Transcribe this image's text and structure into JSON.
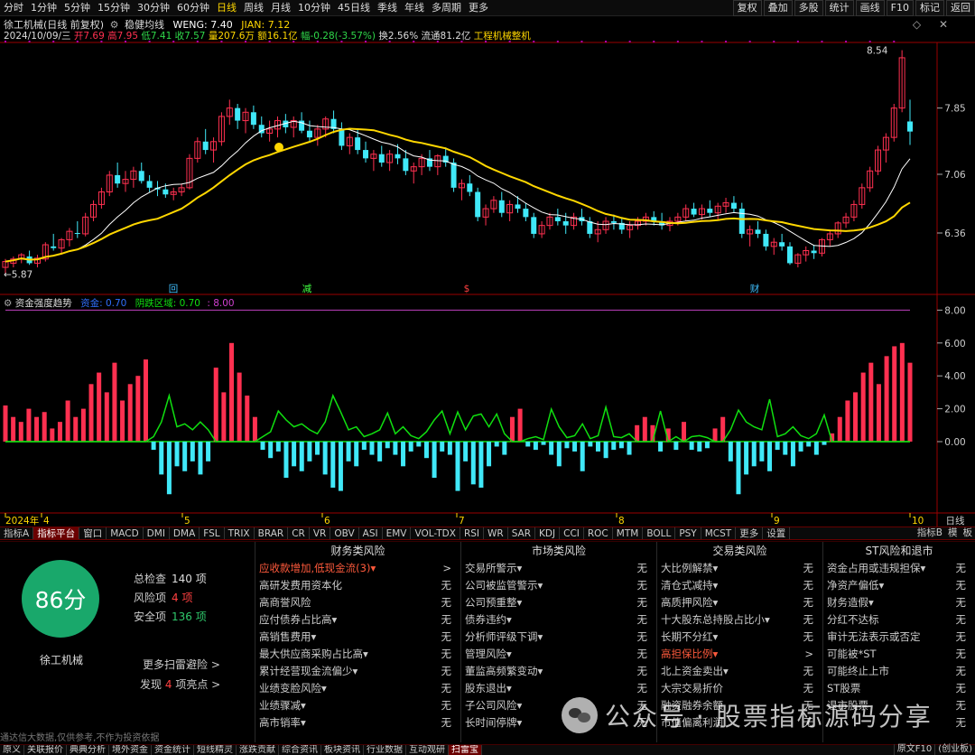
{
  "colors": {
    "up": "#ff3050",
    "down": "#40e8f8",
    "ma1": "#ffd700",
    "ma2": "#ffffff",
    "green": "#10e010",
    "purple": "#b000b0",
    "frame": "#9a0000"
  },
  "periods": [
    "分时",
    "1分钟",
    "5分钟",
    "15分钟",
    "30分钟",
    "60分钟",
    "日线",
    "周线",
    "月线",
    "10分钟",
    "45日线",
    "季线",
    "年线",
    "多周期",
    "更多"
  ],
  "active_period": "日线",
  "top_right": [
    "复权",
    "叠加",
    "多股",
    "统计",
    "画线",
    "F10",
    "标记",
    "返回"
  ],
  "title_line": {
    "name": "徐工机械(日线 前复权)",
    "indicator": "稳健均线",
    "weng": "WENG: 7.40",
    "jian": "JIAN: 7.12"
  },
  "info_line": {
    "date": "2024/10/09/三",
    "open": "开7.69",
    "high": "高7.95",
    "low": "低7.41",
    "close": "收7.57",
    "volume": "量207.6万",
    "amount": "额16.1亿",
    "change": "幅-0.28(-3.57%)",
    "turnover": "换2.56%",
    "float": "流通81.2亿",
    "sector": "工程机械整机"
  },
  "price_axis": {
    "labels": [
      "7.85",
      "7.06",
      "6.36"
    ],
    "max_label": "8.54",
    "min_label": "5.87"
  },
  "events": [
    "回",
    "减",
    "$",
    "财"
  ],
  "ind_head": {
    "name": "资金强度趋势",
    "a": "资金: 0.70",
    "b": "阴跌区域: 0.70",
    "c": ": 8.00"
  },
  "ind_axis": [
    "8.00",
    "6.00",
    "4.00",
    "2.00",
    "0.00"
  ],
  "date_axis": [
    "2024年",
    "4",
    "5",
    "6",
    "7",
    "8",
    "9",
    "10"
  ],
  "date_axis_label": "日线",
  "tabs": [
    "指标A",
    "指标平台",
    "窗口",
    "MACD",
    "DMI",
    "DMA",
    "FSL",
    "TRIX",
    "BRAR",
    "CR",
    "VR",
    "OBV",
    "ASI",
    "EMV",
    "VOL-TDX",
    "RSI",
    "WR",
    "SAR",
    "KDJ",
    "CCI",
    "ROC",
    "MTM",
    "BOLL",
    "PSY",
    "MCST",
    "更多",
    "设置"
  ],
  "active_tab": "指标平台",
  "tab_right": [
    "指标B",
    "模",
    "板"
  ],
  "score": {
    "value": "86分",
    "name": "徐工机械",
    "total_label": "总检查",
    "total": "140 项",
    "risk_label": "风险项",
    "risk": "4 项",
    "safe_label": "安全项",
    "safe": "136 项",
    "more": "更多扫雷避险 >",
    "found_pre": "发现",
    "found_num": "4",
    "found_post": "项亮点 >"
  },
  "columns": [
    {
      "title": "财务类风险",
      "rows": [
        [
          "应收款增加,低现金流(3)▾",
          ">"
        ],
        [
          "高研发费用资本化",
          "无"
        ],
        [
          "高商誉风险",
          "无"
        ],
        [
          "应付债券占比高▾",
          "无"
        ],
        [
          "高销售费用▾",
          "无"
        ],
        [
          "最大供应商采购占比高▾",
          "无"
        ],
        [
          "累计经营现金流偏少▾",
          "无"
        ],
        [
          "业绩变脸风险▾",
          "无"
        ],
        [
          "业绩骤减▾",
          "无"
        ],
        [
          "高市销率▾",
          "无"
        ]
      ],
      "hl": 0
    },
    {
      "title": "市场类风险",
      "rows": [
        [
          "交易所警示▾",
          "无"
        ],
        [
          "公司被监管警示▾",
          "无"
        ],
        [
          "公司预重整▾",
          "无"
        ],
        [
          "债券违约▾",
          "无"
        ],
        [
          "分析师评级下调▾",
          "无"
        ],
        [
          "管理风险▾",
          "无"
        ],
        [
          "董监高频繁变动▾",
          "无"
        ],
        [
          "股东退出▾",
          "无"
        ],
        [
          "子公司风险▾",
          "无"
        ],
        [
          "长时间停牌▾",
          "无"
        ]
      ],
      "hl": -1
    },
    {
      "title": "交易类风险",
      "rows": [
        [
          "大比例解禁▾",
          "无"
        ],
        [
          "清仓式减持▾",
          "无"
        ],
        [
          "高质押风险▾",
          "无"
        ],
        [
          "十大股东总持股占比小▾",
          "无"
        ],
        [
          "长期不分红▾",
          "无"
        ],
        [
          "高担保比例▾",
          ">"
        ],
        [
          "北上资金卖出▾",
          "无"
        ],
        [
          "大宗交易折价",
          "无"
        ],
        [
          "融资融券余额",
          "无"
        ],
        [
          "市值偏离利润",
          "无"
        ]
      ],
      "hl": 5
    },
    {
      "title": "ST风险和退市",
      "rows": [
        [
          "资金占用或违规担保▾",
          "无"
        ],
        [
          "净资产偏低▾",
          "无"
        ],
        [
          "财务造假▾",
          "无"
        ],
        [
          "分红不达标",
          "无"
        ],
        [
          "审计无法表示或否定",
          "无"
        ],
        [
          "可能被*ST",
          "无"
        ],
        [
          "可能终止上市",
          "无"
        ],
        [
          "ST股票",
          "无"
        ],
        [
          "退市股票",
          "无"
        ],
        [
          "",
          "无"
        ]
      ],
      "hl": -1
    }
  ],
  "disclaimer": "通达信大数据,仅供参考,不作为投资依据",
  "bottom_tabs": [
    "原义",
    "关联报价",
    "典典分析",
    "境外资金",
    "资金统计",
    "短线精灵",
    "涨跌贡献",
    "综合资讯",
    "板块资讯",
    "行业数据",
    "互动观研",
    "扫雷宝"
  ],
  "active_bottom": "扫雷宝",
  "bottom_right": [
    "原文F10",
    "(创业板)"
  ],
  "watermark": "公众号 · 股票指标源码分享",
  "chart_data": {
    "type": "candlestick",
    "candles": [
      [
        5.95,
        6.05,
        5.88,
        6.02
      ],
      [
        6.0,
        6.08,
        5.95,
        6.05
      ],
      [
        6.05,
        6.12,
        6.0,
        6.1
      ],
      [
        6.08,
        6.15,
        5.98,
        6.0
      ],
      [
        6.0,
        6.1,
        5.95,
        6.06
      ],
      [
        6.05,
        6.25,
        6.02,
        6.22
      ],
      [
        6.2,
        6.35,
        6.15,
        6.18
      ],
      [
        6.18,
        6.3,
        6.1,
        6.28
      ],
      [
        6.28,
        6.42,
        6.2,
        6.38
      ],
      [
        6.36,
        6.5,
        6.3,
        6.35
      ],
      [
        6.35,
        6.6,
        6.32,
        6.55
      ],
      [
        6.55,
        6.75,
        6.5,
        6.7
      ],
      [
        6.7,
        6.9,
        6.65,
        6.85
      ],
      [
        6.85,
        7.1,
        6.8,
        7.05
      ],
      [
        7.05,
        7.2,
        6.9,
        6.95
      ],
      [
        6.95,
        7.1,
        6.85,
        7.0
      ],
      [
        7.0,
        7.15,
        6.9,
        7.1
      ],
      [
        7.1,
        7.2,
        6.95,
        6.98
      ],
      [
        6.98,
        7.05,
        6.85,
        6.9
      ],
      [
        6.9,
        6.98,
        6.8,
        6.88
      ],
      [
        6.88,
        6.95,
        6.78,
        6.82
      ],
      [
        6.82,
        6.9,
        6.75,
        6.85
      ],
      [
        6.85,
        6.95,
        6.8,
        6.9
      ],
      [
        6.9,
        7.3,
        6.88,
        7.25
      ],
      [
        7.25,
        7.5,
        7.2,
        7.45
      ],
      [
        7.45,
        7.6,
        7.3,
        7.35
      ],
      [
        7.35,
        7.5,
        7.2,
        7.45
      ],
      [
        7.45,
        7.8,
        7.4,
        7.75
      ],
      [
        7.75,
        7.95,
        7.65,
        7.85
      ],
      [
        7.85,
        7.9,
        7.6,
        7.7
      ],
      [
        7.7,
        7.85,
        7.55,
        7.8
      ],
      [
        7.8,
        7.88,
        7.6,
        7.65
      ],
      [
        7.65,
        7.75,
        7.5,
        7.55
      ],
      [
        7.55,
        7.7,
        7.45,
        7.6
      ],
      [
        7.6,
        7.75,
        7.5,
        7.7
      ],
      [
        7.7,
        7.78,
        7.55,
        7.62
      ],
      [
        7.62,
        7.75,
        7.5,
        7.7
      ],
      [
        7.7,
        7.8,
        7.55,
        7.58
      ],
      [
        7.58,
        7.7,
        7.45,
        7.5
      ],
      [
        7.5,
        7.65,
        7.4,
        7.6
      ],
      [
        7.6,
        7.75,
        7.5,
        7.72
      ],
      [
        7.72,
        7.82,
        7.55,
        7.6
      ],
      [
        7.6,
        7.68,
        7.35,
        7.4
      ],
      [
        7.4,
        7.55,
        7.3,
        7.5
      ],
      [
        7.5,
        7.6,
        7.3,
        7.35
      ],
      [
        7.35,
        7.45,
        7.2,
        7.25
      ],
      [
        7.25,
        7.35,
        7.1,
        7.3
      ],
      [
        7.3,
        7.4,
        7.15,
        7.2
      ],
      [
        7.2,
        7.35,
        7.1,
        7.3
      ],
      [
        7.3,
        7.42,
        7.18,
        7.25
      ],
      [
        7.25,
        7.35,
        7.05,
        7.1
      ],
      [
        7.1,
        7.2,
        6.95,
        7.15
      ],
      [
        7.15,
        7.3,
        7.05,
        7.25
      ],
      [
        7.25,
        7.35,
        7.1,
        7.15
      ],
      [
        7.15,
        7.3,
        7.05,
        7.28
      ],
      [
        7.28,
        7.38,
        7.15,
        7.2
      ],
      [
        7.2,
        7.25,
        6.85,
        6.9
      ],
      [
        6.9,
        7.0,
        6.75,
        6.95
      ],
      [
        6.95,
        7.05,
        6.8,
        6.85
      ],
      [
        6.85,
        6.9,
        6.5,
        6.55
      ],
      [
        6.55,
        6.7,
        6.45,
        6.65
      ],
      [
        6.65,
        6.8,
        6.6,
        6.75
      ],
      [
        6.75,
        6.85,
        6.55,
        6.6
      ],
      [
        6.6,
        6.75,
        6.5,
        6.7
      ],
      [
        6.7,
        6.8,
        6.6,
        6.65
      ],
      [
        6.65,
        6.72,
        6.5,
        6.55
      ],
      [
        6.55,
        6.6,
        6.3,
        6.35
      ],
      [
        6.35,
        6.5,
        6.3,
        6.45
      ],
      [
        6.45,
        6.6,
        6.4,
        6.55
      ],
      [
        6.55,
        6.65,
        6.45,
        6.5
      ],
      [
        6.5,
        6.6,
        6.35,
        6.45
      ],
      [
        6.45,
        6.6,
        6.4,
        6.55
      ],
      [
        6.55,
        6.65,
        6.45,
        6.5
      ],
      [
        6.5,
        6.55,
        6.3,
        6.35
      ],
      [
        6.35,
        6.5,
        6.25,
        6.4
      ],
      [
        6.4,
        6.55,
        6.35,
        6.5
      ],
      [
        6.5,
        6.58,
        6.4,
        6.48
      ],
      [
        6.48,
        6.55,
        6.35,
        6.4
      ],
      [
        6.4,
        6.5,
        6.3,
        6.45
      ],
      [
        6.45,
        6.55,
        6.4,
        6.5
      ],
      [
        6.5,
        6.6,
        6.45,
        6.55
      ],
      [
        6.55,
        6.62,
        6.45,
        6.5
      ],
      [
        6.5,
        6.6,
        6.4,
        6.45
      ],
      [
        6.45,
        6.55,
        6.38,
        6.5
      ],
      [
        6.5,
        6.6,
        6.45,
        6.55
      ],
      [
        6.55,
        6.7,
        6.5,
        6.65
      ],
      [
        6.65,
        6.72,
        6.55,
        6.58
      ],
      [
        6.58,
        6.7,
        6.52,
        6.65
      ],
      [
        6.65,
        6.75,
        6.55,
        6.6
      ],
      [
        6.6,
        6.72,
        6.52,
        6.68
      ],
      [
        6.68,
        6.78,
        6.6,
        6.72
      ],
      [
        6.72,
        6.8,
        6.6,
        6.65
      ],
      [
        6.65,
        6.72,
        6.3,
        6.35
      ],
      [
        6.35,
        6.45,
        6.2,
        6.4
      ],
      [
        6.4,
        6.5,
        6.3,
        6.35
      ],
      [
        6.35,
        6.4,
        6.15,
        6.2
      ],
      [
        6.2,
        6.3,
        6.1,
        6.25
      ],
      [
        6.25,
        6.35,
        6.15,
        6.2
      ],
      [
        6.2,
        6.25,
        5.98,
        6.0
      ],
      [
        6.0,
        6.12,
        5.95,
        6.1
      ],
      [
        6.1,
        6.2,
        6.02,
        6.15
      ],
      [
        6.15,
        6.22,
        6.05,
        6.12
      ],
      [
        6.12,
        6.3,
        6.08,
        6.28
      ],
      [
        6.28,
        6.4,
        6.2,
        6.35
      ],
      [
        6.35,
        6.5,
        6.3,
        6.48
      ],
      [
        6.48,
        6.6,
        6.42,
        6.55
      ],
      [
        6.55,
        6.75,
        6.5,
        6.7
      ],
      [
        6.7,
        6.95,
        6.65,
        6.9
      ],
      [
        6.9,
        7.15,
        6.85,
        7.1
      ],
      [
        7.1,
        7.4,
        7.05,
        7.35
      ],
      [
        7.35,
        7.55,
        7.2,
        7.5
      ],
      [
        7.5,
        7.9,
        7.45,
        7.85
      ],
      [
        7.85,
        8.54,
        7.8,
        8.45
      ],
      [
        7.69,
        7.95,
        7.41,
        7.57
      ]
    ],
    "flow": [
      2.2,
      1.5,
      1.2,
      2.0,
      1.5,
      1.8,
      0.8,
      1.2,
      2.5,
      1.5,
      2.0,
      3.5,
      4.2,
      3.0,
      4.8,
      2.5,
      3.5,
      4.0,
      5.0,
      -0.5,
      -2.0,
      -3.2,
      -1.5,
      -1.8,
      -1.2,
      -2.0,
      -1.2,
      4.5,
      3.0,
      6.0,
      4.2,
      2.8,
      1.5,
      -0.5,
      -1.0,
      -0.6,
      -2.2,
      -1.5,
      -1.8,
      -1.2,
      -0.8,
      -2.0,
      -2.8,
      -3.0,
      -1.2,
      -1.5,
      -0.5,
      -0.8,
      -1.2,
      -0.4,
      -0.8,
      -1.5,
      -0.6,
      -0.3,
      -1.0,
      -2.2,
      -0.6,
      -0.8,
      -3.0,
      -1.2,
      -2.6,
      -2.8,
      -1.5,
      -0.3,
      -0.8,
      1.5,
      2.0,
      -0.3,
      -0.5,
      -0.2,
      -0.8,
      -1.5,
      -0.4,
      -0.6,
      -1.8,
      -0.3,
      -0.6,
      -1.0,
      -0.5,
      -0.4,
      -0.8,
      1.0,
      1.5,
      1.0,
      -0.6,
      0.8,
      -0.5,
      1.2,
      -0.5,
      -0.6,
      -0.4,
      0.8,
      1.5,
      -1.2,
      -3.2,
      -2.0,
      -1.5,
      -1.2,
      -1.8,
      -0.5,
      -0.8,
      -1.5,
      -0.6,
      -0.3,
      -0.8,
      -0.2,
      0.5,
      1.5,
      2.5,
      3.0,
      4.2,
      4.8,
      3.5,
      5.2,
      5.8,
      6.0,
      4.8
    ]
  }
}
